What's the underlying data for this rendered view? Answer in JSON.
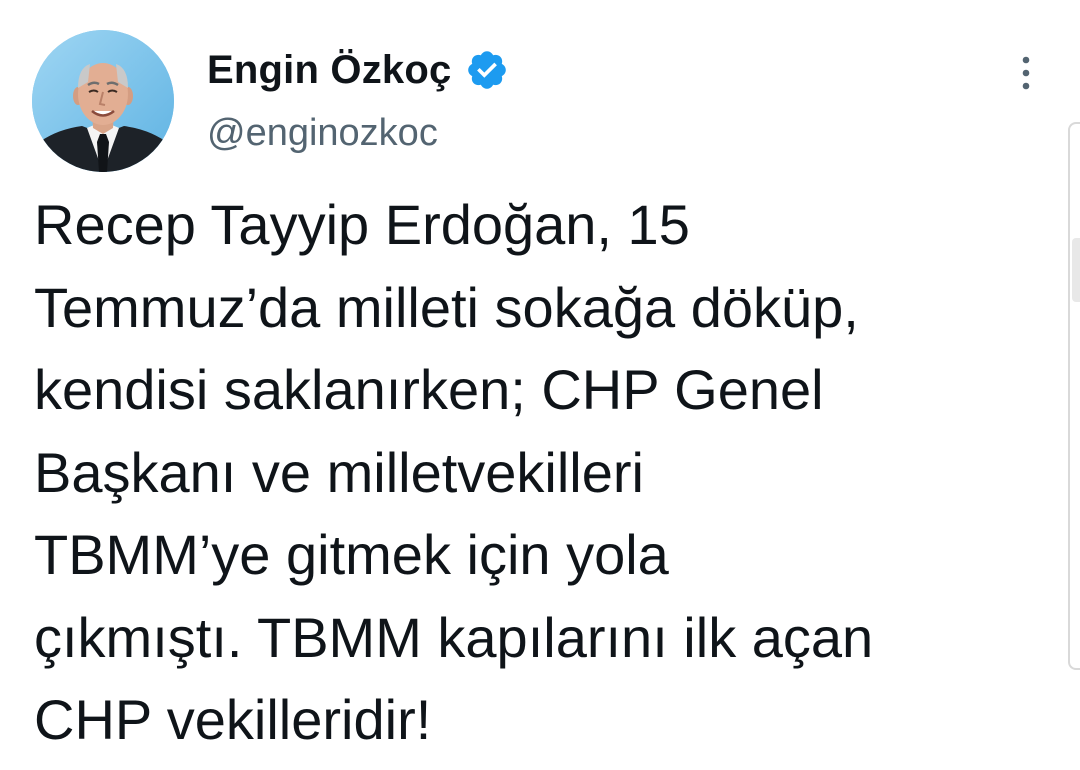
{
  "tweet": {
    "author": {
      "display_name": "Engin Özkoç",
      "handle": "@enginozkoc",
      "verified": true,
      "verified_badge_color": "#1d9bf0"
    },
    "text": "Recep Tayyip Erdoğan, 15\nTemmuz’da milleti sokağa döküp,\nkendisi saklanırken; CHP Genel\nBaşkanı ve milletvekilleri\nTBMM’ye gitmek için yola\nçıkmıştı. TBMM kapılarını ilk açan\nCHP vekilleridir!"
  },
  "icons": {
    "more": "more-vertical-icon",
    "verified": "verified-badge-icon"
  },
  "colors": {
    "text_primary": "#0f1419",
    "text_secondary": "#536471",
    "accent": "#1d9bf0",
    "avatar_background": "#7cc4ea"
  }
}
